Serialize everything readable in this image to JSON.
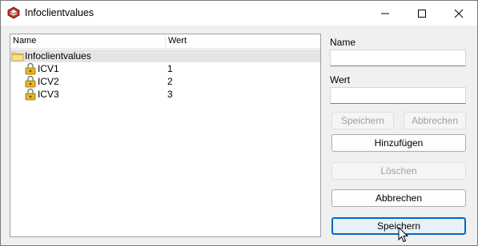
{
  "window": {
    "title": "Infoclientvalues"
  },
  "tree": {
    "columns": {
      "name": "Name",
      "value": "Wert"
    },
    "root": {
      "label": "Infoclientvalues",
      "icon": "folder-icon"
    },
    "items": [
      {
        "name": "ICV1",
        "value": "1",
        "icon": "key-lock-icon"
      },
      {
        "name": "ICV2",
        "value": "2",
        "icon": "key-lock-icon"
      },
      {
        "name": "ICV3",
        "value": "3",
        "icon": "key-lock-icon"
      }
    ]
  },
  "form": {
    "name_label": "Name",
    "name_value": "",
    "value_label": "Wert",
    "value_value": ""
  },
  "buttons": {
    "save_small": "Speichern",
    "cancel_small": "Abbrechen",
    "add": "Hinzufügen",
    "delete": "Löschen",
    "cancel": "Abbrechen",
    "save": "Speichern"
  },
  "colors": {
    "accent": "#0067c0",
    "selection": "#e5e5e5",
    "disabled_text": "#a0a0a0"
  }
}
